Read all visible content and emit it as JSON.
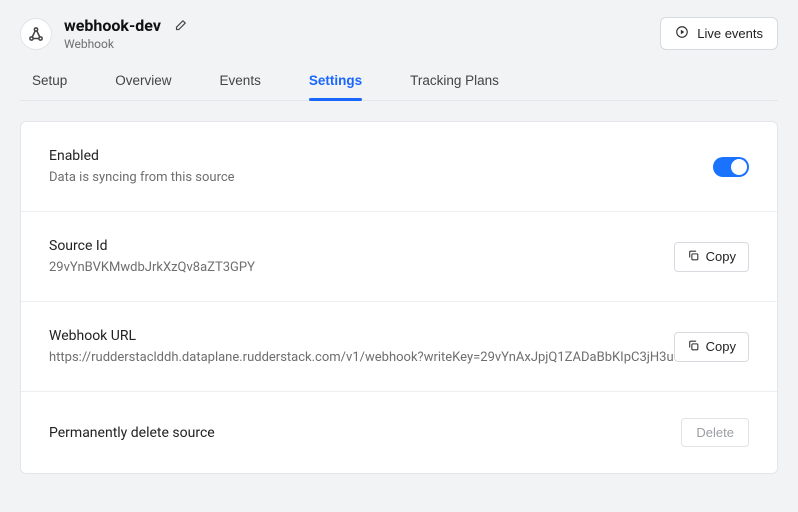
{
  "header": {
    "title": "webhook-dev",
    "subtitle": "Webhook",
    "live_events_label": "Live events"
  },
  "tabs": {
    "setup": "Setup",
    "overview": "Overview",
    "events": "Events",
    "settings": "Settings",
    "tracking_plans": "Tracking Plans"
  },
  "sections": {
    "enabled": {
      "title": "Enabled",
      "desc": "Data is syncing from this source",
      "toggle_on": true
    },
    "source_id": {
      "title": "Source Id",
      "value": "29vYnBVKMwdbJrkXzQv8aZT3GPY",
      "copy_label": "Copy"
    },
    "webhook_url": {
      "title": "Webhook URL",
      "value": "https://rudderstaclddh.dataplane.rudderstack.com/v1/webhook?writeKey=29vYnAxJpjQ1ZADaBbKIpC3jH3u",
      "copy_label": "Copy"
    },
    "delete": {
      "title": "Permanently delete source",
      "button_label": "Delete"
    }
  }
}
